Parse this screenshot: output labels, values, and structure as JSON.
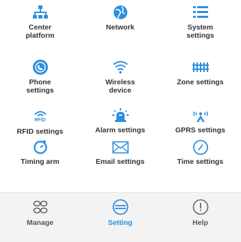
{
  "colors": {
    "accent": "#2d8fde",
    "text": "#333333",
    "tab_inactive": "#555555"
  },
  "grid": [
    {
      "label": "Center\nplatform",
      "icon": "network-nodes-icon"
    },
    {
      "label": "Network",
      "icon": "globe-icon"
    },
    {
      "label": "System\nsettings",
      "icon": "list-icon"
    },
    {
      "label": "Phone\nsettings",
      "icon": "phone-circle-icon"
    },
    {
      "label": "Wireless\ndevice",
      "icon": "wifi-icon"
    },
    {
      "label": "Zone settings",
      "icon": "fence-icon"
    },
    {
      "label": "RFID settings",
      "icon": "rfid-icon"
    },
    {
      "label": "Alarm settings",
      "icon": "alarm-icon"
    },
    {
      "label": "GPRS settings",
      "icon": "gprs-icon"
    },
    {
      "label": "Timing arm",
      "icon": "timer-icon"
    },
    {
      "label": "Email settings",
      "icon": "envelope-icon"
    },
    {
      "label": "Time settings",
      "icon": "clock-icon"
    }
  ],
  "rfid_icon_text": "RFID",
  "tabs": [
    {
      "label": "Manage",
      "icon": "grid-circles-icon",
      "active": false
    },
    {
      "label": "Setting",
      "icon": "settings-circle-icon",
      "active": true
    },
    {
      "label": "Help",
      "icon": "help-icon",
      "active": false
    }
  ]
}
